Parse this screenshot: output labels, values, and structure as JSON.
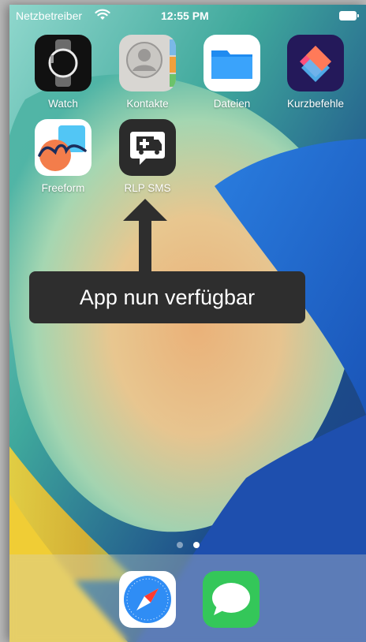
{
  "status_bar": {
    "carrier": "Netzbetreiber",
    "time": "12:55 PM"
  },
  "apps": [
    {
      "label": "Watch",
      "icon": "watch-icon"
    },
    {
      "label": "Kontakte",
      "icon": "contacts-icon"
    },
    {
      "label": "Dateien",
      "icon": "files-icon"
    },
    {
      "label": "Kurzbefehle",
      "icon": "shortcuts-icon"
    },
    {
      "label": "Freeform",
      "icon": "freeform-icon"
    },
    {
      "label": "RLP SMS",
      "icon": "ambulance-message-icon"
    }
  ],
  "tooltip": {
    "text": "App nun verfügbar"
  },
  "page_indicator": {
    "pages": 2,
    "current": 2
  },
  "dock": [
    {
      "icon": "safari-icon"
    },
    {
      "icon": "messages-icon"
    }
  ],
  "colors": {
    "tooltip_bg": "#2e2e2e",
    "wallpaper_blue": "#1f6fd6",
    "wallpaper_orange": "#f2a560",
    "wallpaper_teal": "#5fc9b0"
  }
}
